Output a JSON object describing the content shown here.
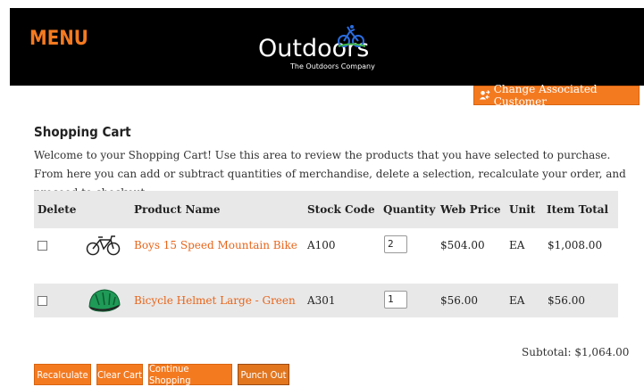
{
  "header": {
    "menu_label": "MENU",
    "logo_text": "Outdoors",
    "logo_subtitle": "The Outdoors Company"
  },
  "associate_button": {
    "label": "Change Associated Customer",
    "icon": "user-swap-icon"
  },
  "cart": {
    "title": "Shopping Cart",
    "welcome": "Welcome to your Shopping Cart! Use this area to review the products that you have selected to purchase. From here you can add or subtract quantities of merchandise, delete a selection, recalculate your order, and proceed to checkout.",
    "columns": {
      "delete": "Delete",
      "product_name": "Product Name",
      "stock_code": "Stock Code",
      "quantity": "Quantity",
      "web_price": "Web Price",
      "unit": "Unit",
      "item_total": "Item Total"
    },
    "items": [
      {
        "name": "Boys 15 Speed Mountain Bike",
        "stock_code": "A100",
        "quantity": "2",
        "web_price": "$504.00",
        "unit": "EA",
        "item_total": "$1,008.00",
        "image": "bicycle-image"
      },
      {
        "name": "Bicycle Helmet Large - Green",
        "stock_code": "A301",
        "quantity": "1",
        "web_price": "$56.00",
        "unit": "EA",
        "item_total": "$56.00",
        "image": "helmet-image"
      }
    ],
    "subtotal": "Subtotal: $1,064.00"
  },
  "buttons": {
    "recalculate": "Recalculate",
    "clear_cart": "Clear Cart",
    "continue_shopping": "Continue Shopping",
    "punch_out": "Punch Out"
  },
  "colors": {
    "accent": "#f47a20",
    "link": "#e8651a",
    "header_bg": "#000000",
    "row_alt": "#e8e8e8"
  }
}
